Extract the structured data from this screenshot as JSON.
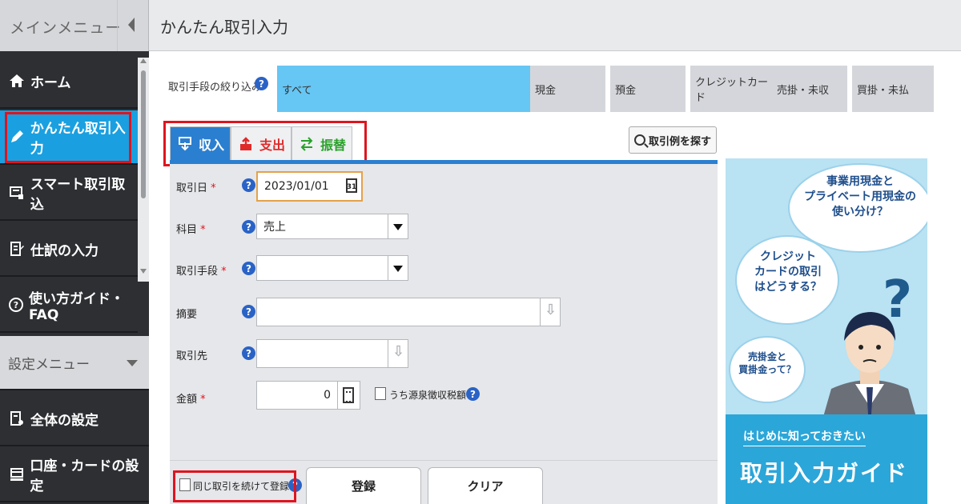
{
  "header": {
    "menu_label": "メインメニュー",
    "page_title": "かんたん取引入力"
  },
  "sidebar": {
    "items": [
      {
        "label": "ホーム",
        "icon": "home-icon"
      },
      {
        "label": "かんたん取引入力",
        "icon": "pencil-icon",
        "active": true
      },
      {
        "label": "スマート取引取込",
        "icon": "import-icon"
      },
      {
        "label": "仕訳の入力",
        "icon": "journal-icon"
      },
      {
        "label": "使い方ガイド・FAQ",
        "icon": "help-icon"
      }
    ],
    "settings_header": "設定メニュー",
    "settings_items": [
      {
        "label": "全体の設定",
        "icon": "settings-doc-icon"
      },
      {
        "label": "口座・カードの設定",
        "icon": "card-icon"
      }
    ]
  },
  "filter": {
    "label": "取引手段の絞り込み",
    "options": [
      "すべて",
      "現金",
      "預金",
      "クレジットカード",
      "売掛・未収",
      "買掛・未払"
    ],
    "selected": "すべて"
  },
  "tabs": [
    {
      "label": "収入",
      "icon": "income-icon"
    },
    {
      "label": "支出",
      "icon": "expense-icon"
    },
    {
      "label": "振替",
      "icon": "transfer-icon"
    }
  ],
  "find_example_label": "取引例を探す",
  "form": {
    "date": {
      "label": "取引日",
      "required_mark": "*",
      "value": "2023/01/01",
      "calendar_text": "31"
    },
    "account": {
      "label": "科目",
      "required_mark": "*",
      "value": "売上"
    },
    "method": {
      "label": "取引手段",
      "required_mark": "*",
      "value": ""
    },
    "memo": {
      "label": "摘要",
      "value": ""
    },
    "partner": {
      "label": "取引先",
      "value": ""
    },
    "amount": {
      "label": "金額",
      "required_mark": "*",
      "value": "0"
    },
    "withholding_label": "うち源泉徴収税額"
  },
  "bottom": {
    "repeat_label": "同じ取引を続けて登録",
    "register_label": "登録",
    "clear_label": "クリア"
  },
  "ad": {
    "bubble1": "事業用現金と\nプライベート用現金の\n使い分け？",
    "bubble2": "クレジット\nカードの取引\nはどうする？",
    "bubble3": "売掛金と\n買掛金って？",
    "sub": "はじめに知っておきたい",
    "main": "取引入力ガイド",
    "qmark": "?"
  },
  "colors": {
    "accent": "#1aa0e0",
    "income": "#2b7fd0",
    "expense": "#e02a2a",
    "transfer": "#2aa02a",
    "highlight_box": "#e0141e"
  }
}
